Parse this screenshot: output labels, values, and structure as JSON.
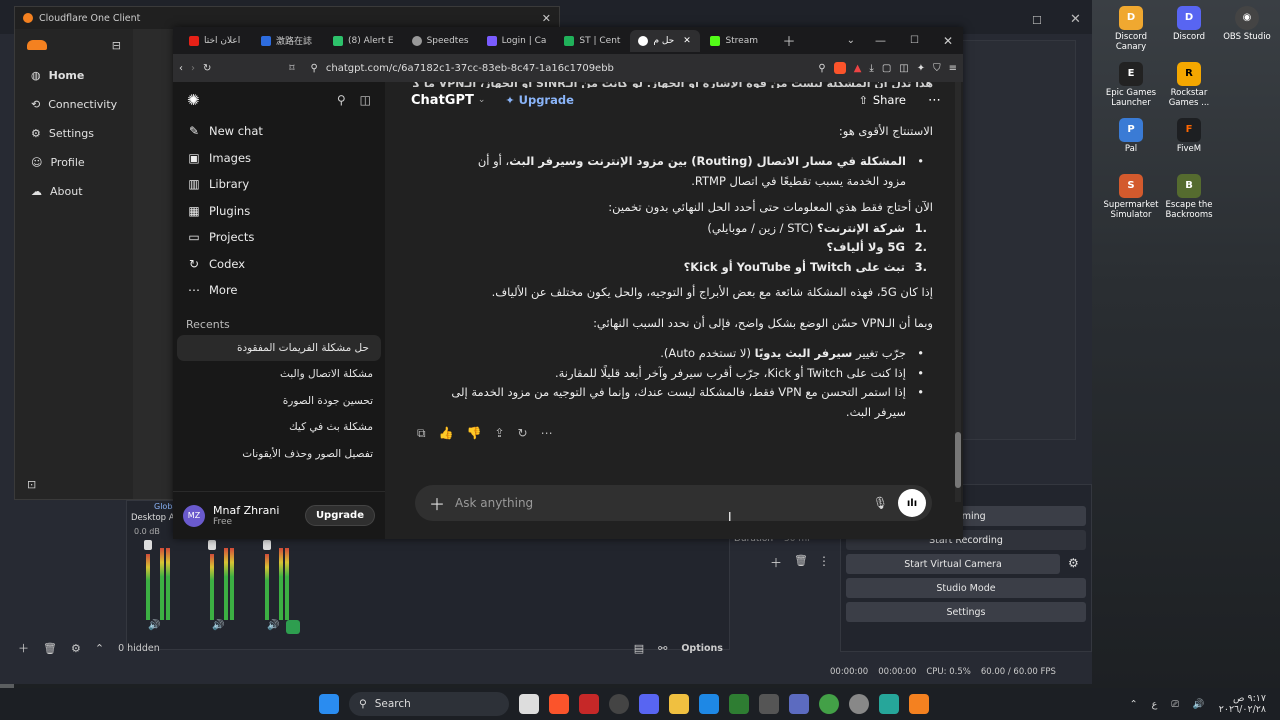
{
  "desktop": {
    "icons": [
      {
        "label": "Discord Canary",
        "color": "#f0a830"
      },
      {
        "label": "Discord",
        "color": "#5865f2"
      },
      {
        "label": "OBS Studio",
        "color": "#444"
      },
      {
        "label": "Epic Games Launcher",
        "color": "#222"
      },
      {
        "label": "Rockstar Games ...",
        "color": "#f4a700"
      },
      {
        "label": "Pal",
        "color": "#3a7bd5"
      },
      {
        "label": "FiveM",
        "color": "#1d1f22"
      },
      {
        "label": "Supermarket Simulator",
        "color": "#d35a2d"
      },
      {
        "label": "Escape the Backrooms",
        "color": "#556b2f"
      }
    ]
  },
  "obs": {
    "buttons": [
      "reaming",
      "Start Recording",
      "Start Virtual Camera",
      "Studio Mode",
      "Settings"
    ],
    "duration_label": "Duration",
    "duration_value": "50 ml",
    "desktop_audio": "Desktop A",
    "global_label": "Globa",
    "db_label": "0.0 dB",
    "hidden_label": "0 hidden",
    "options_label": "Options",
    "status": {
      "t1": "00:00:00",
      "t2": "00:00:00",
      "cpu": "CPU: 0.5%",
      "fps": "60.00 / 60.00 FPS"
    }
  },
  "cloudflare": {
    "title": "Cloudflare One Client",
    "nav": [
      {
        "label": "Home",
        "icon": "globe-icon"
      },
      {
        "label": "Connectivity",
        "icon": "link-icon"
      },
      {
        "label": "Settings",
        "icon": "gear-icon"
      },
      {
        "label": "Profile",
        "icon": "user-icon"
      },
      {
        "label": "About",
        "icon": "cloud-icon"
      }
    ]
  },
  "browser": {
    "tabs": [
      {
        "label": "اعلان اختا",
        "color": "#e62117"
      },
      {
        "label": "激路在誌",
        "color": "#2d6cdf"
      },
      {
        "label": "(8) Alert E",
        "color": "#2dc26b"
      },
      {
        "label": "Speedtes",
        "color": "#999"
      },
      {
        "label": "Login | Ca",
        "color": "#7a5cff"
      },
      {
        "label": "ST | Cent",
        "color": "#20b15a"
      },
      {
        "label": "حل م",
        "color": "#ffffff"
      },
      {
        "label": "Stream",
        "color": "#53fc18"
      }
    ],
    "url": "chatgpt.com/c/6a7182c1-37cc-83eb-8c47-1a16c1709ebb"
  },
  "chatgpt": {
    "model": "ChatGPT",
    "upgrade": "Upgrade",
    "share": "Share",
    "nav": [
      {
        "label": "New chat",
        "icon": "edit-icon",
        "glyph": "✎"
      },
      {
        "label": "Images",
        "icon": "image-icon",
        "glyph": "▣"
      },
      {
        "label": "Library",
        "icon": "library-icon",
        "glyph": "▥"
      },
      {
        "label": "Plugins",
        "icon": "plugin-icon",
        "glyph": "▦"
      },
      {
        "label": "Projects",
        "icon": "folder-icon",
        "glyph": "▭"
      },
      {
        "label": "Codex",
        "icon": "codex-icon",
        "glyph": "↻"
      },
      {
        "label": "More",
        "icon": "more-icon",
        "glyph": "⋯"
      }
    ],
    "recents_label": "Recents",
    "recents": [
      "حل مشكلة الفريمات المفقودة",
      "مشكلة الاتصال والبث",
      "تحسين جودة الصورة",
      "مشكلة بث في كيك",
      "تفصيل الصور وحذف الأيقونات"
    ],
    "user": {
      "initials": "MZ",
      "name": "Mnaf Zhrani",
      "plan": "Free",
      "upgrade": "Upgrade"
    },
    "input_placeholder": "Ask anything",
    "message": {
      "cut_top": "هذا تدل أن المشكلة ليست من قوة الإشارة أو الجهاز. لو كانت من الـSINR أو الجهاز، الـVPN ما كان",
      "conclusion_title": "الاستنتاج الأقوى هو:",
      "bullet1_bold": "المشكلة في مسار الاتصال (Routing) بين مزود الإنترنت وسيرفر البث",
      "bullet1_rest": "، أو أن مزود الخدمة يسبب تقطيعًا في اتصال RTMP.",
      "need_info": "الآن أحتاج فقط هذي المعلومات حتى أحدد الحل النهائي بدون تخمين:",
      "q1_bold": "شركة الإنترنت؟",
      "q1_rest": " (STC / زين / موبايلي)",
      "q2_bold": "5G ولا ألياف؟",
      "q3_bold": "تبث على Twitch أو YouTube أو Kick؟",
      "if5g": "إذا كان 5G، فهذه المشكلة شائعة مع بعض الأبراج أو التوجيه، والحل يكون مختلف عن الألياف.",
      "vpn_note": "وبما أن الـVPN حسّن الوضع بشكل واضح، فإلى أن نحدد السبب النهائي:",
      "tip1_pre": "جرّب تغيير ",
      "tip1_bold": "سيرفر البث يدويًا",
      "tip1_rest": " (لا تستخدم Auto).",
      "tip2": "إذا كنت على Twitch أو Kick، جرّب أقرب سيرفر وآخر أبعد قليلًا للمقارنة.",
      "tip3": "إذا استمر التحسن مع VPN فقط، فالمشكلة ليست عندك، وإنما في التوجيه من مزود الخدمة إلى سيرفر البث."
    }
  },
  "taskbar": {
    "search": "Search",
    "time": "٩:١٧ ص",
    "date": "٢٠٢٦/٠٢/٢٨",
    "lang": "ع"
  }
}
